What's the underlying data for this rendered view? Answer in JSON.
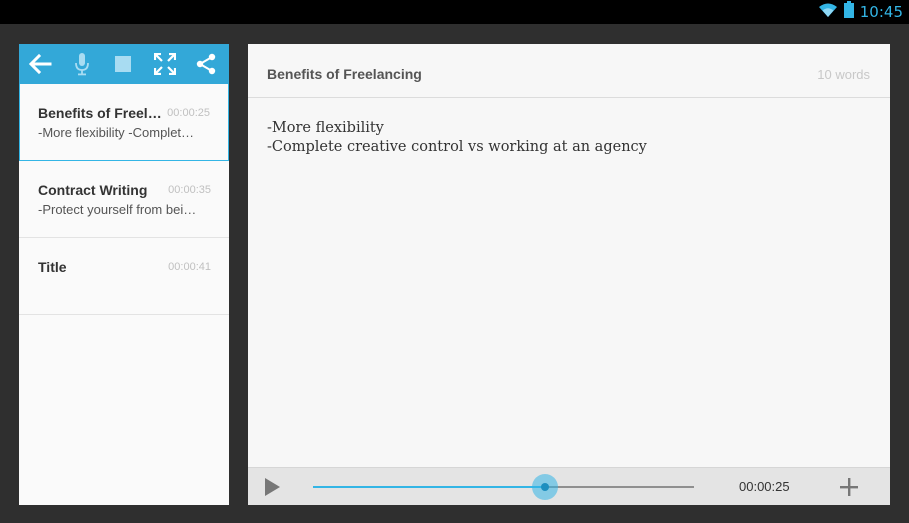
{
  "status_bar": {
    "time": "10:45"
  },
  "toolbar": {
    "buttons": [
      "back-arrow-icon",
      "microphone-icon",
      "stop-icon",
      "fullscreen-icon",
      "share-icon"
    ]
  },
  "notes": [
    {
      "title": "Benefits of Freelan…",
      "time": "00:00:25",
      "snippet": "-More flexibility -Complet…",
      "selected": true
    },
    {
      "title": "Contract Writing",
      "time": "00:00:35",
      "snippet": "-Protect yourself from bei…",
      "selected": false
    },
    {
      "title": "Title",
      "time": "00:00:41",
      "snippet": "",
      "selected": false
    }
  ],
  "editor": {
    "title": "Benefits of Freelancing",
    "word_count": "10 words",
    "lines": [
      "-More flexibility",
      "-Complete creative control vs working at an agency"
    ]
  },
  "player": {
    "current_time": "00:00:25",
    "progress_percent": 61
  },
  "colors": {
    "accent": "#33b5e5",
    "toolbar": "#33a8d8",
    "background": "#2f2f2f"
  }
}
